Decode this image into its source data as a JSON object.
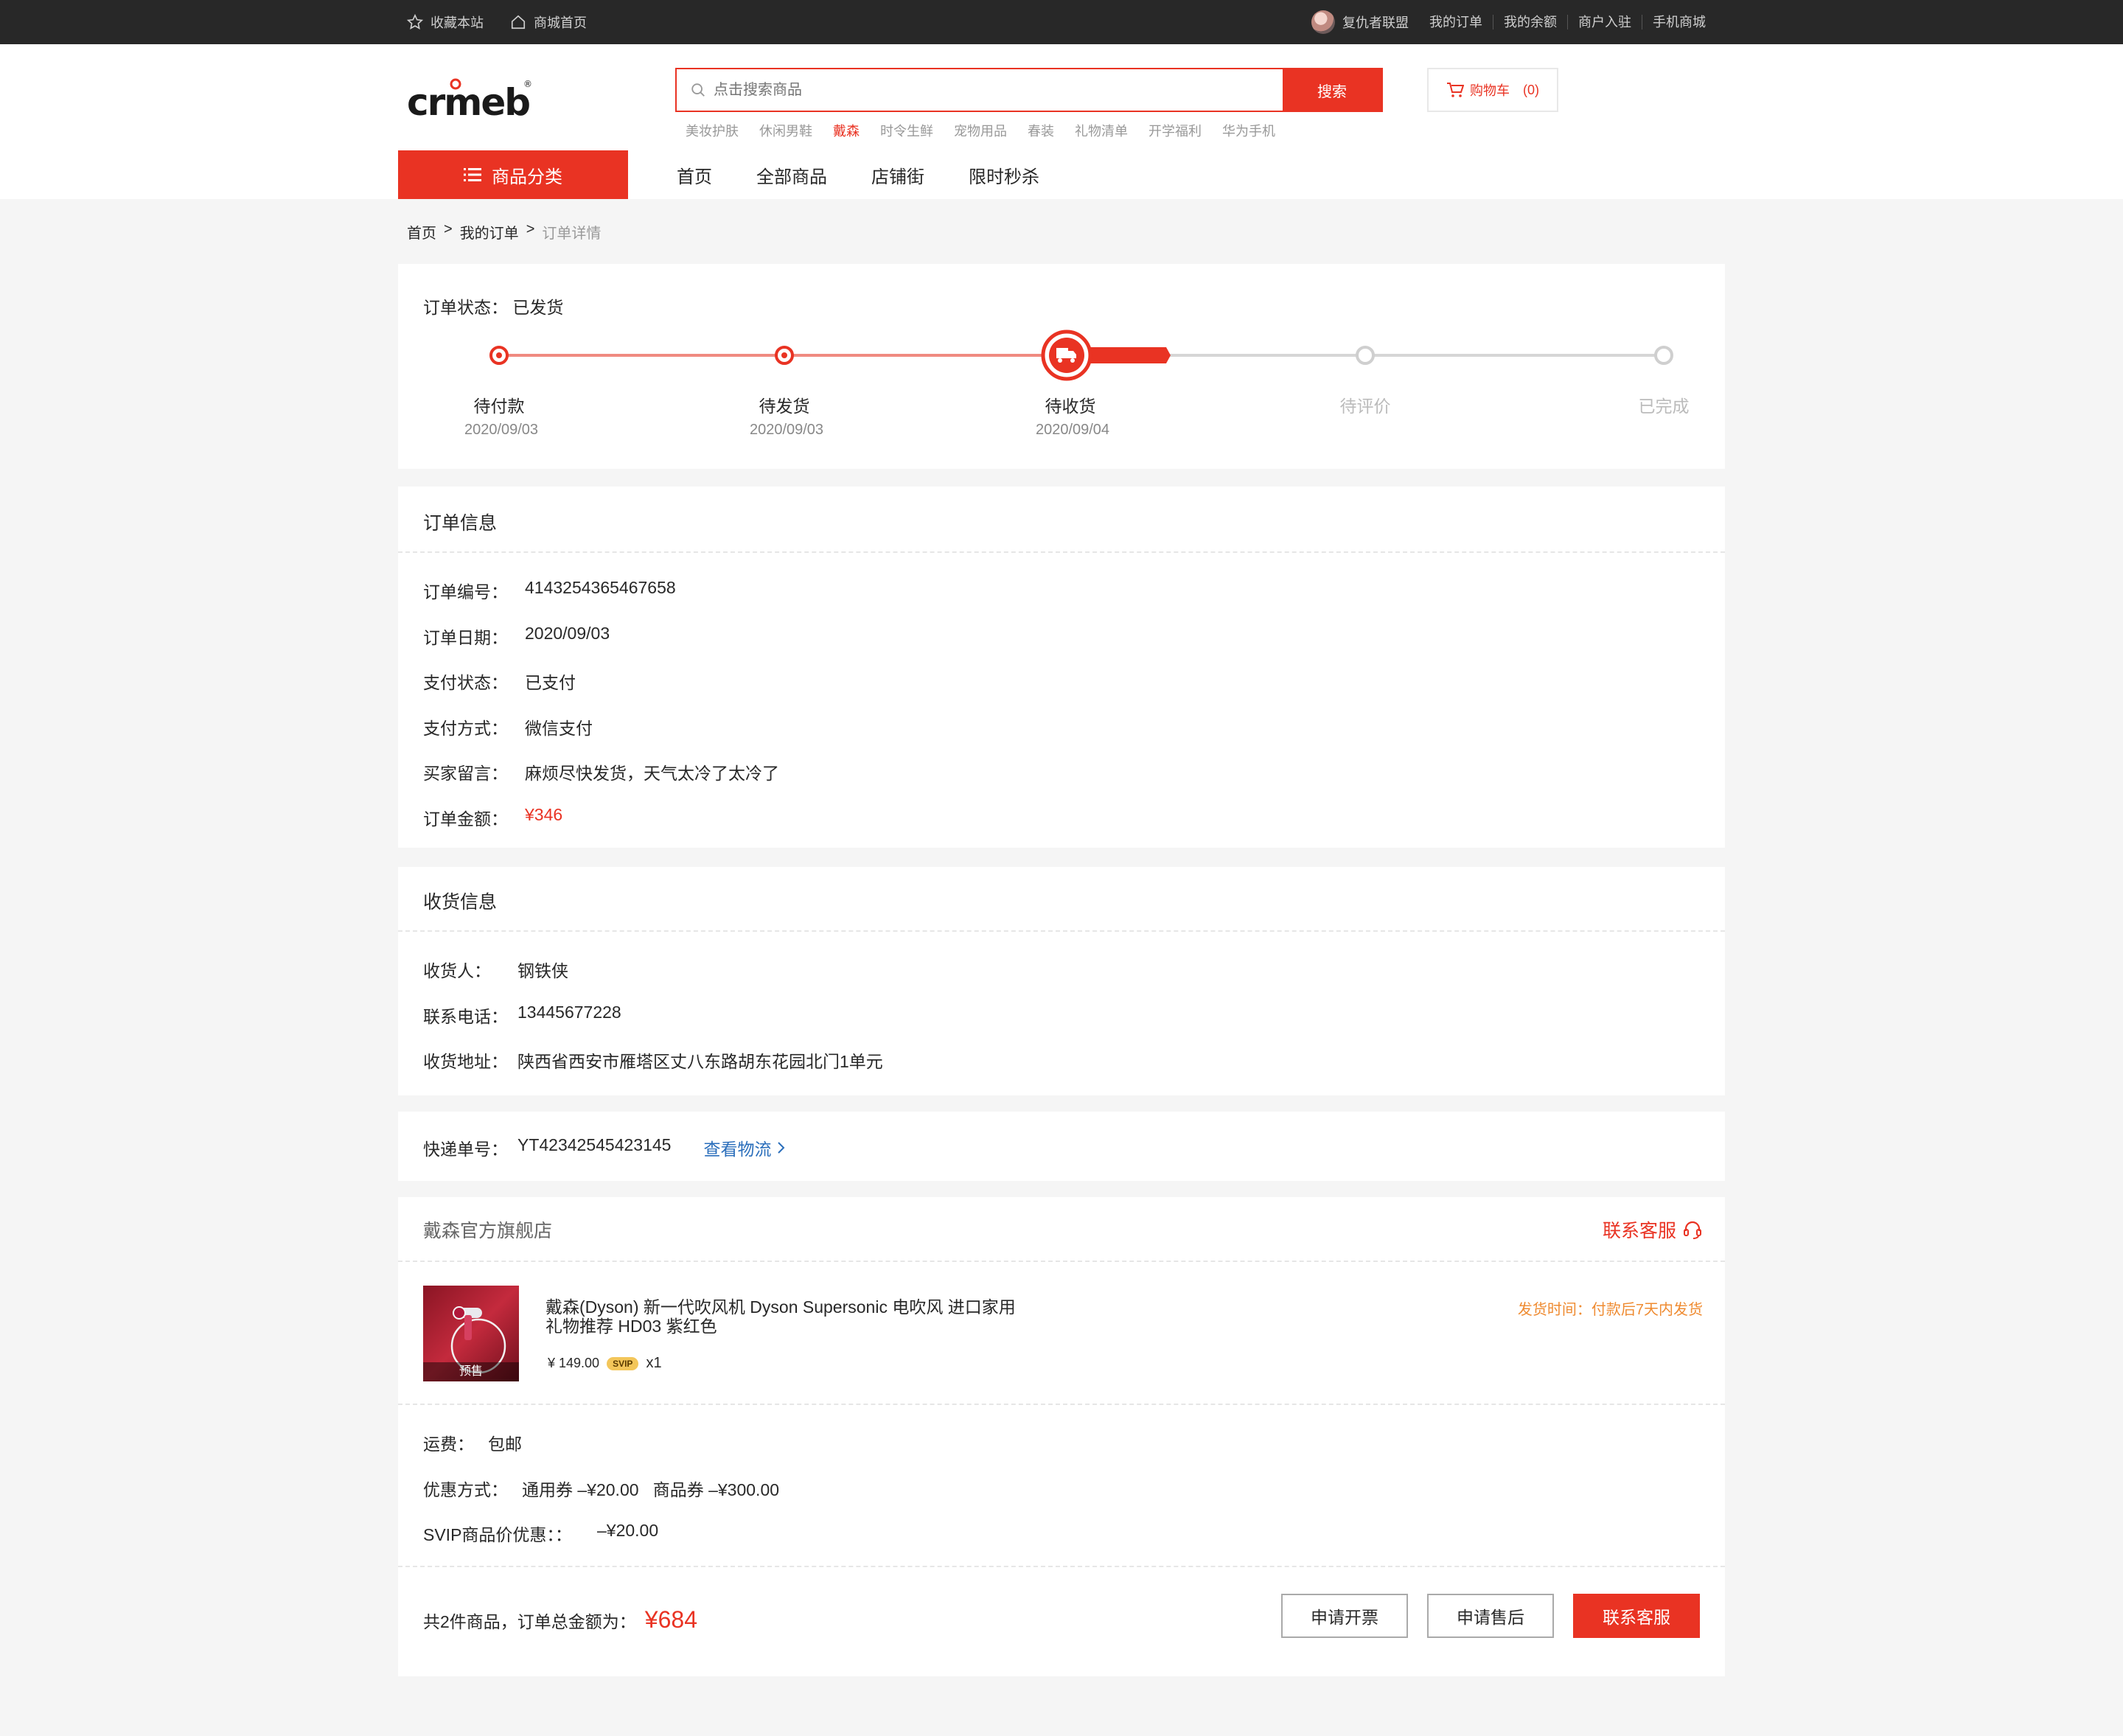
{
  "topbar": {
    "favorite": "收藏本站",
    "home": "商城首页",
    "user_name": "复仇者联盟",
    "links": [
      "我的订单",
      "我的余额",
      "商户入驻",
      "手机商城"
    ]
  },
  "header": {
    "logo_text": "crmeb",
    "search_placeholder": "点击搜索商品",
    "search_button": "搜索",
    "cart_label": "购物车",
    "cart_count": "(0)",
    "hot_words": [
      "美妆护肤",
      "休闲男鞋",
      "戴森",
      "时令生鲜",
      "宠物用品",
      "春装",
      "礼物清单",
      "开学福利",
      "华为手机"
    ],
    "hot_active_index": 2,
    "category_button": "商品分类",
    "nav": [
      "首页",
      "全部商品",
      "店铺街",
      "限时秒杀"
    ]
  },
  "breadcrumb": {
    "items": [
      "首页",
      "我的订单",
      "订单详情"
    ],
    "separator": ">"
  },
  "status": {
    "label": "订单状态：",
    "value": "已发货",
    "steps": [
      {
        "name": "待付款",
        "date": "2020/09/03"
      },
      {
        "name": "待发货",
        "date": "2020/09/03"
      },
      {
        "name": "待收货",
        "date": "2020/09/04"
      },
      {
        "name": "待评价",
        "date": ""
      },
      {
        "name": "已完成",
        "date": ""
      }
    ],
    "current_step": 2
  },
  "order_info": {
    "title": "订单信息",
    "rows": [
      {
        "k": "订单编号：",
        "v": "4143254365467658"
      },
      {
        "k": "订单日期：",
        "v": "2020/09/03"
      },
      {
        "k": "支付状态：",
        "v": "已支付"
      },
      {
        "k": "支付方式：",
        "v": "微信支付"
      },
      {
        "k": "买家留言：",
        "v": "麻烦尽快发货，天气太冷了太冷了"
      },
      {
        "k": "订单金额：",
        "v": "¥346"
      }
    ]
  },
  "receiver": {
    "title": "收货信息",
    "rows": [
      {
        "k": "收货人：",
        "v": "钢铁侠"
      },
      {
        "k": "联系电话：",
        "v": "13445677228"
      },
      {
        "k": "收货地址：",
        "v": "陕西省西安市雁塔区丈八东路胡东花园北门1单元"
      }
    ]
  },
  "express": {
    "label": "快递单号：",
    "number": "YT42342545423145",
    "link": "查看物流"
  },
  "store": {
    "name": "戴森官方旗舰店",
    "contact": "联系客服",
    "product": {
      "title": "戴森(Dyson) 新一代吹风机 Dyson Supersonic 电吹风 进口家用 礼物推荐 HD03 紫红色",
      "price": "¥ 149.00",
      "svip": "SVIP",
      "qty": "x1",
      "badge": "预售",
      "ship_time": "发货时间：付款后7天内发货"
    },
    "fees": [
      {
        "k": "运费：",
        "v": "包邮"
      },
      {
        "k": "优惠方式：",
        "v": "通用券 –¥20.00   商品券 –¥300.00"
      },
      {
        "k": "SVIP商品价优惠：：",
        "v": "–¥20.00"
      }
    ],
    "total_text": "共2件商品，订单总金额为：",
    "total_amount": "¥684",
    "buttons": [
      "申请开票",
      "申请售后",
      "联系客服"
    ]
  },
  "colors": {
    "accent": "#e93323",
    "topbar": "#282828",
    "orange": "#ef8b31",
    "link_blue": "#2a6ebb"
  }
}
